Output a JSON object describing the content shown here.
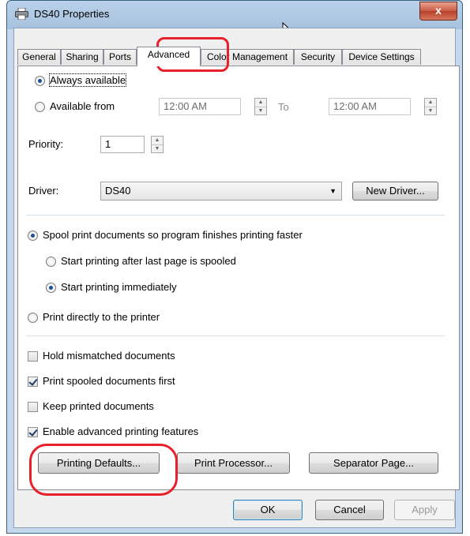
{
  "window": {
    "title": "DS40 Properties",
    "close_label": "x",
    "title_icon": "printer-icon"
  },
  "tabs": [
    {
      "label": "General",
      "active": false
    },
    {
      "label": "Sharing",
      "active": false
    },
    {
      "label": "Ports",
      "active": false
    },
    {
      "label": "Advanced",
      "active": true
    },
    {
      "label": "Color Management",
      "active": false
    },
    {
      "label": "Security",
      "active": false
    },
    {
      "label": "Device Settings",
      "active": false
    }
  ],
  "availability": {
    "always_label": "Always available",
    "from_label": "Available from",
    "from_time": "12:00 AM",
    "to_label": "To",
    "to_time": "12:00 AM"
  },
  "priority": {
    "label": "Priority:",
    "value": "1"
  },
  "driver": {
    "label": "Driver:",
    "value": "DS40",
    "new_driver_label": "New Driver..."
  },
  "spool": {
    "spool_label": "Spool print documents so program finishes printing faster",
    "after_last_page_label": "Start printing after last page is spooled",
    "immediately_label": "Start printing immediately",
    "direct_label": "Print directly to the printer"
  },
  "options": {
    "hold_mismatched": {
      "label": "Hold mismatched documents",
      "checked": false
    },
    "spooled_first": {
      "label": "Print spooled documents first",
      "checked": true
    },
    "keep_printed": {
      "label": "Keep printed documents",
      "checked": false
    },
    "advanced_features": {
      "label": "Enable advanced printing features",
      "checked": true
    }
  },
  "buttons": {
    "printing_defaults": "Printing Defaults...",
    "print_processor": "Print Processor...",
    "separator_page": "Separator Page...",
    "ok": "OK",
    "cancel": "Cancel",
    "apply": "Apply"
  },
  "colors": {
    "annotation": "#e8202a",
    "titlebar": "#b9d1ea",
    "close_button": "#c75b45"
  }
}
